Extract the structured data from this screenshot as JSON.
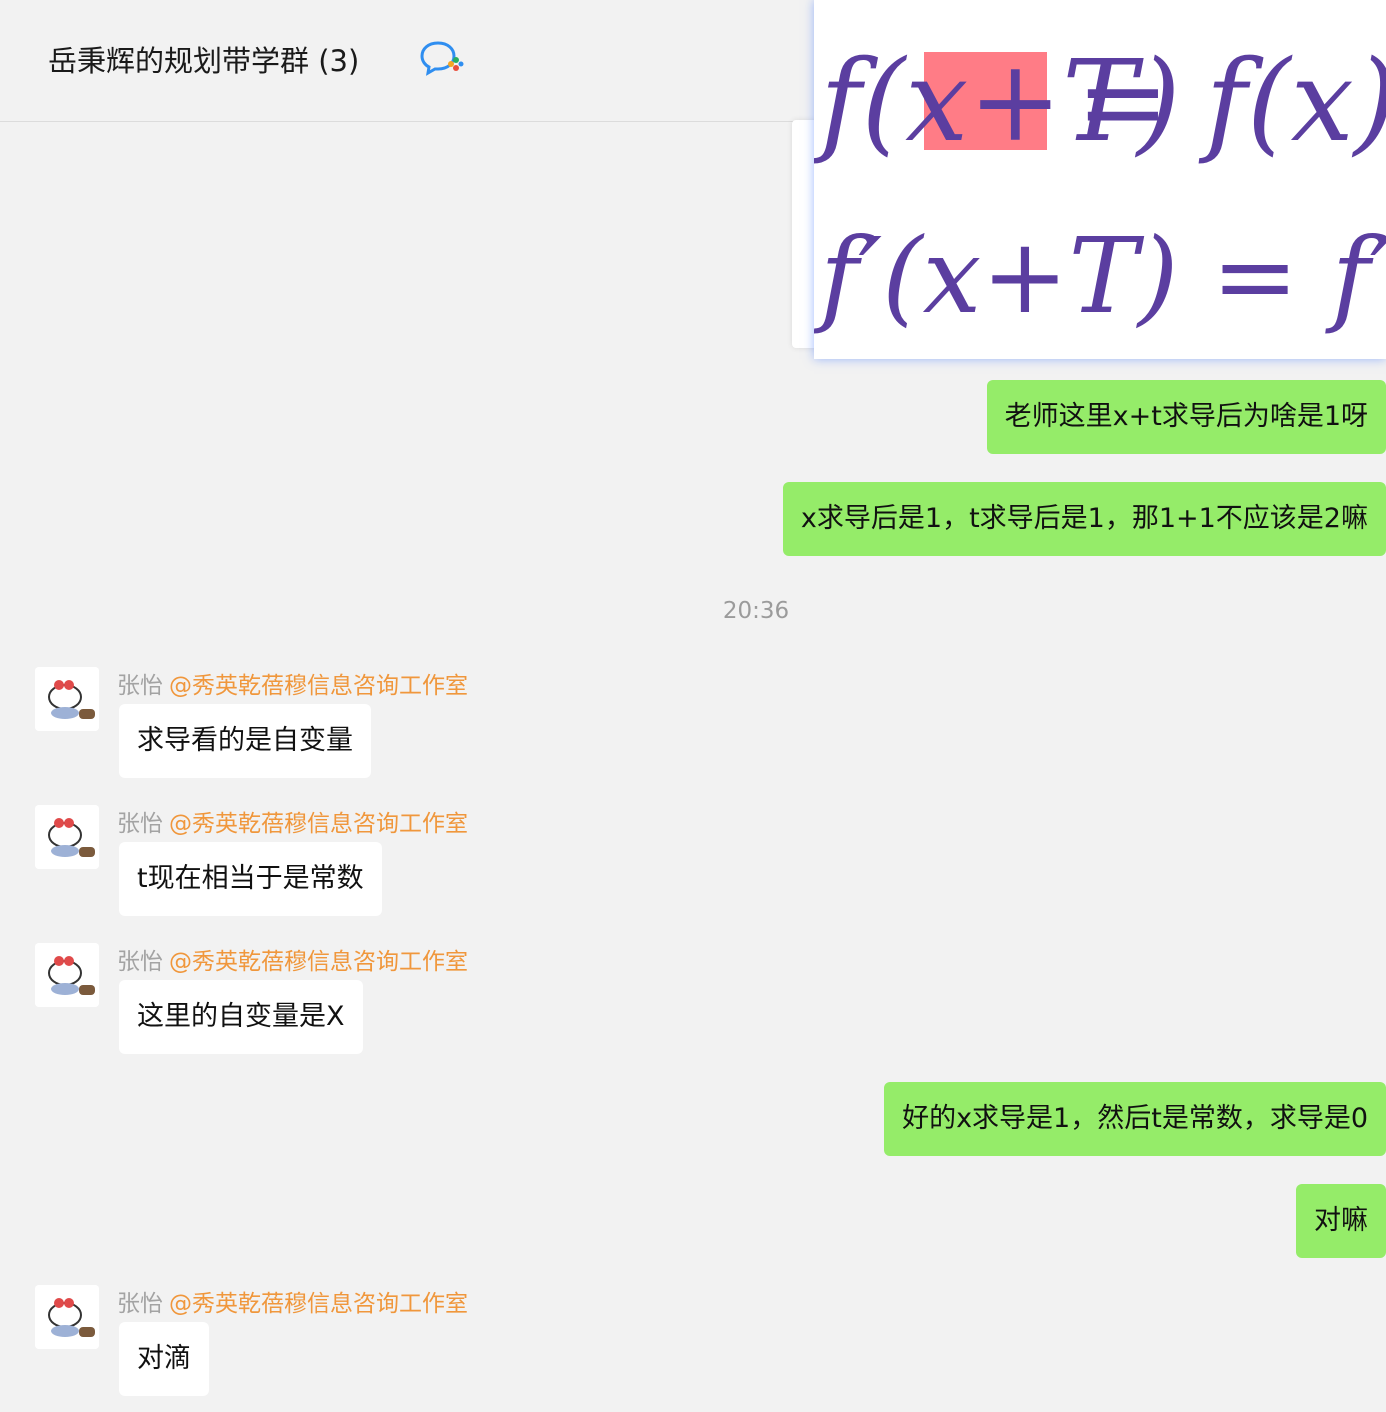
{
  "header": {
    "title": "岳秉辉的规划带学群 (3)",
    "chat_icon": "chat-bubbles-icon"
  },
  "formula_image": {
    "line1_left": "f(x+T)",
    "line1_right": "= f(x)",
    "line2": "f′(x+T) = f′(x)",
    "highlight": "x+T"
  },
  "timestamp": "20:36",
  "messages": {
    "m1": "老师这里x+t求导后为啥是1呀",
    "m2": "x求导后是1，t求导后是1，那1+1不应该是2嘛",
    "m3": "求导看的是自变量",
    "m4": "t现在相当于是常数",
    "m5": "这里的自变量是X",
    "m6": "好的x求导是1，然后t是常数，求导是0",
    "m7": "对嘛",
    "m8": "对滴"
  },
  "sender": {
    "name": "张怡",
    "mention": "@秀英乾蓓穆信息咨询工作室"
  },
  "colors": {
    "my_bubble": "#95ec69",
    "other_bubble": "#ffffff",
    "background": "#f2f2f2",
    "mention": "#f0973c",
    "ink": "#5b3ea0",
    "highlight": "#ff7c86"
  }
}
